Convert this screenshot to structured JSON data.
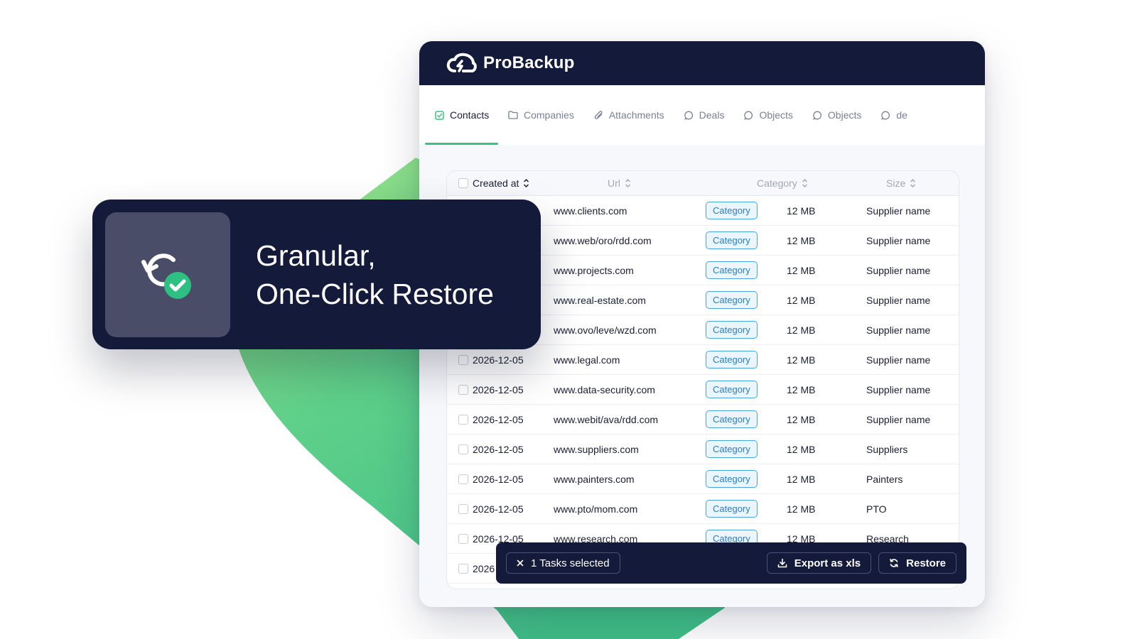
{
  "brand": {
    "name": "ProBackup"
  },
  "feature": {
    "title": "Granular,\nOne-Click Restore",
    "icon": "restore-check-icon"
  },
  "tabs": [
    {
      "label": "Contacts",
      "icon": "checkbox-icon",
      "active": true
    },
    {
      "label": "Companies",
      "icon": "folder-icon"
    },
    {
      "label": "Attachments",
      "icon": "paperclip-icon"
    },
    {
      "label": "Deals",
      "icon": "chat-bubble-icon"
    },
    {
      "label": "Objects",
      "icon": "chat-bubble-icon"
    },
    {
      "label": "Objects",
      "icon": "chat-bubble-icon"
    },
    {
      "label": "de",
      "icon": "chat-bubble-icon"
    }
  ],
  "table": {
    "columns": {
      "created": "Created at",
      "url": "Url",
      "category": "Category",
      "size": "Size"
    },
    "rows": [
      {
        "date": "",
        "url": "www.clients.com",
        "category": "Category",
        "size": "12 MB",
        "supplier": "Supplier name"
      },
      {
        "date": "",
        "url": "www.web/oro/rdd.com",
        "category": "Category",
        "size": "12 MB",
        "supplier": "Supplier name"
      },
      {
        "date": "",
        "url": "www.projects.com",
        "category": "Category",
        "size": "12 MB",
        "supplier": "Supplier name"
      },
      {
        "date": "",
        "url": "www.real-estate.com",
        "category": "Category",
        "size": "12 MB",
        "supplier": "Supplier name"
      },
      {
        "date": "",
        "url": "www.ovo/leve/wzd.com",
        "category": "Category",
        "size": "12 MB",
        "supplier": "Supplier name"
      },
      {
        "date": "2026-12-05",
        "url": "www.legal.com",
        "category": "Category",
        "size": "12 MB",
        "supplier": "Supplier name"
      },
      {
        "date": "2026-12-05",
        "url": "www.data-security.com",
        "category": "Category",
        "size": "12 MB",
        "supplier": "Supplier name"
      },
      {
        "date": "2026-12-05",
        "url": "www.webit/ava/rdd.com",
        "category": "Category",
        "size": "12 MB",
        "supplier": "Supplier name"
      },
      {
        "date": "2026-12-05",
        "url": "www.suppliers.com",
        "category": "Category",
        "size": "12 MB",
        "supplier": "Suppliers"
      },
      {
        "date": "2026-12-05",
        "url": "www.painters.com",
        "category": "Category",
        "size": "12 MB",
        "supplier": "Painters"
      },
      {
        "date": "2026-12-05",
        "url": "www.pto/mom.com",
        "category": "Category",
        "size": "12 MB",
        "supplier": "PTO"
      },
      {
        "date": "2026-12-05",
        "url": "www.research.com",
        "category": "Category",
        "size": "12 MB",
        "supplier": "Research"
      },
      {
        "date": "2026",
        "url": "",
        "category": "",
        "size": "",
        "supplier": ""
      }
    ]
  },
  "action_bar": {
    "selected_label": "1 Tasks selected",
    "export_label": "Export as xls",
    "restore_label": "Restore"
  },
  "colors": {
    "navy": "#141a3a",
    "accent_green": "#38c283",
    "badge_blue": "#2b7fc0"
  }
}
